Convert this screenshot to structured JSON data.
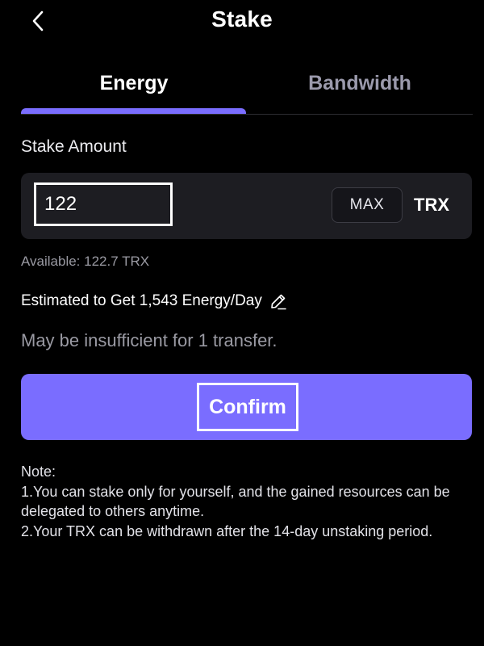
{
  "header": {
    "back_icon": "chevron-left-icon",
    "title": "Stake"
  },
  "tabs": [
    {
      "label": "Energy",
      "active": true
    },
    {
      "label": "Bandwidth",
      "active": false
    }
  ],
  "stake": {
    "label": "Stake Amount",
    "amount_value": "122",
    "max_label": "MAX",
    "token": "TRX",
    "available": "Available: 122.7 TRX",
    "estimate": "Estimated to Get 1,543 Energy/Day",
    "edit_icon": "pencil-icon",
    "warning": "May be insufficient for 1 transfer."
  },
  "confirm_label": "Confirm",
  "note": {
    "title": "Note:",
    "line1": "1.You can stake only for yourself, and the gained resources can be delegated to others anytime.",
    "line2": "2.Your TRX can be withdrawn after the 14-day unstaking period."
  },
  "colors": {
    "accent": "#7a6dff",
    "background": "#000000",
    "panel": "#1d1d22",
    "muted_text": "#9a9aa3"
  }
}
